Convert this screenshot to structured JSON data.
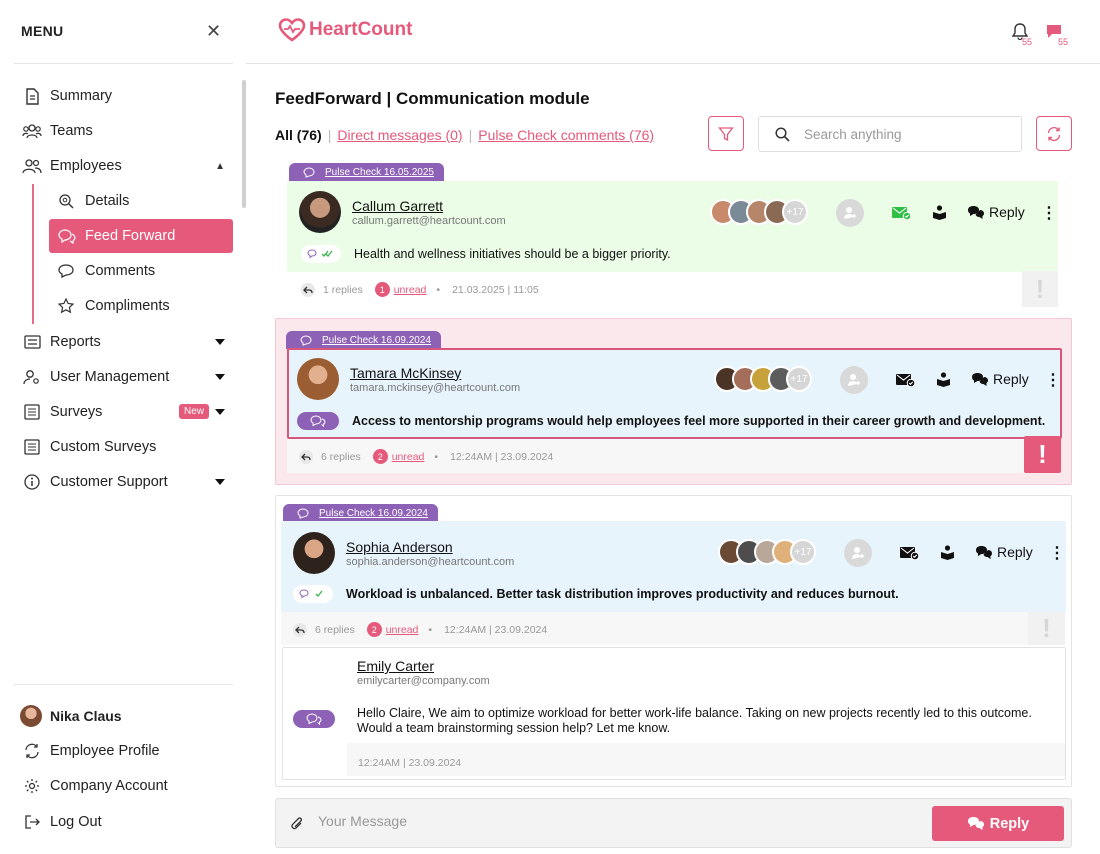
{
  "sidebar": {
    "menu_title": "MENU",
    "items": [
      {
        "label": "Summary"
      },
      {
        "label": "Teams"
      },
      {
        "label": "Employees"
      },
      {
        "label": "Reports"
      },
      {
        "label": "User Management"
      },
      {
        "label": "Surveys",
        "badge": "New"
      },
      {
        "label": "Custom Surveys"
      },
      {
        "label": "Customer Support"
      }
    ],
    "employees_sub": [
      {
        "label": "Details"
      },
      {
        "label": "Feed Forward",
        "active": true
      },
      {
        "label": "Comments"
      },
      {
        "label": "Compliments"
      }
    ],
    "user": {
      "name": "Nika Claus",
      "links": [
        "Employee Profile",
        "Company Account",
        "Log Out"
      ]
    }
  },
  "header": {
    "logo_text": "HeartCount",
    "notifications_count": "55",
    "messages_count": "55"
  },
  "page": {
    "title": "FeedForward | Communication module",
    "filters": {
      "all": "All (76)",
      "direct": "Direct messages (0)",
      "pulse": "Pulse Check comments (76)"
    },
    "search_placeholder": "Search anything"
  },
  "feed": [
    {
      "tag": "Pulse Check 16.05.2025",
      "name": "Callum Garrett",
      "email": "callum.garrett@heartcount.com",
      "more_count": "+17",
      "reply_label": "Reply",
      "text": "Health and wellness initiatives should be a bigger priority.",
      "replies": "1 replies",
      "unread_count": "1",
      "unread_label": "unread",
      "date": "21.03.2025 | 11:05"
    },
    {
      "tag": "Pulse Check 16.09.2024",
      "name": "Tamara McKinsey",
      "email": "tamara.mckinsey@heartcount.com",
      "more_count": "+17",
      "reply_label": "Reply",
      "text": "Access to mentorship programs would help employees feel more supported in their career growth and development.",
      "replies": "6 replies",
      "unread_count": "2",
      "unread_label": "unread",
      "date": "12:24AM | 23.09.2024"
    },
    {
      "tag": "Pulse Check 16.09.2024",
      "name": "Sophia Anderson",
      "email": "sophia.anderson@heartcount.com",
      "more_count": "+17",
      "reply_label": "Reply",
      "text": "Workload is unbalanced. Better task distribution improves productivity and reduces burnout.",
      "replies": "6 replies",
      "unread_count": "2",
      "unread_label": "unread",
      "date": "12:24AM | 23.09.2024",
      "reply": {
        "name": "Emily Carter",
        "email": "emilycarter@company.com",
        "text_line1": "Hello Claire, We aim to optimize workload for better work-life balance. Taking on new projects recently led to this outcome.",
        "text_line2": "Would a team brainstorming session help? Let me know.",
        "date": "12:24AM | 23.09.2024"
      }
    }
  ],
  "composer": {
    "placeholder": "Your Message",
    "send_label": "Reply"
  },
  "colors": {
    "accent": "#e5597b",
    "tag_purple": "#8d62b6",
    "card1_bg": "#ebfde6",
    "card2_bg": "#fbe8ec",
    "msg_blue": "#e8f4fc"
  }
}
